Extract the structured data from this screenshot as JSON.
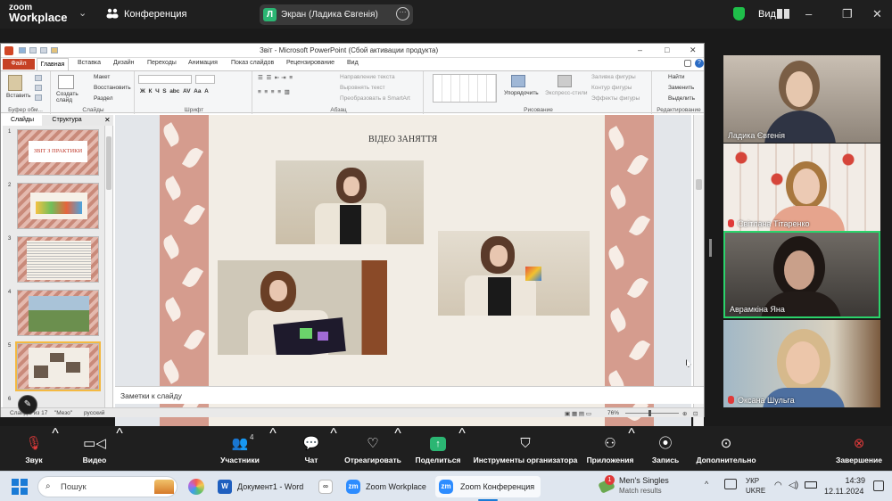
{
  "zoom_top": {
    "logo_line1": "zoom",
    "logo_line2": "Workplace",
    "meeting_title": "Конференция",
    "share_badge": "Л",
    "share_label": "Экран (Ладика Євгенія)",
    "view_label": "Вид"
  },
  "ppt": {
    "window_title": "Звіт - Microsoft PowerPoint (Сбой активации продукта)",
    "tabs": [
      "Файл",
      "Главная",
      "Вставка",
      "Дизайн",
      "Переходы",
      "Анимация",
      "Показ слайдов",
      "Рецензирование",
      "Вид"
    ],
    "ribbon": {
      "paste": "Вставить",
      "create_slide": "Создать слайд",
      "layout": "Макет",
      "restore": "Восстановить",
      "section": "Раздел",
      "text_direction": "Направление текста",
      "align_text": "Выровнять текст",
      "smartart": "Преобразовать в SmartArt",
      "arrange": "Упорядочить",
      "quick_styles": "Экспресс-стили",
      "shape_fill": "Заливка фигуры",
      "shape_outline": "Контур фигуры",
      "shape_effects": "Эффекты фигуры",
      "find": "Найти",
      "replace": "Заменить",
      "select": "Выделить",
      "groups": {
        "clipboard": "Буфер обм...",
        "slides": "Слайды",
        "font": "Шрифт",
        "paragraph": "Абзац",
        "drawing": "Рисование",
        "editing": "Редактирование"
      }
    },
    "pane_tabs": [
      "Слайды",
      "Структура"
    ],
    "thumb1_title": "ЗВІТ З ПРАКТИКИ",
    "thumb_numbers": [
      "1",
      "2",
      "3",
      "4",
      "5",
      "6"
    ],
    "slide_title": "ВІДЕО ЗАНЯТТЯ",
    "notes_placeholder": "Заметки к слайду",
    "status": {
      "slide": "Слайд 5 из 17",
      "theme": "\"Мезо\"",
      "lang": "русский",
      "zoom": "76%"
    }
  },
  "participants": [
    {
      "name": "Ладика Євгенія",
      "muted": false
    },
    {
      "name": "Світлана Тітаренко",
      "muted": true
    },
    {
      "name": "Аврамкіна Яна",
      "muted": false
    },
    {
      "name": "Оксана Шульга",
      "muted": true
    }
  ],
  "toolbar": {
    "audio": "Звук",
    "video": "Видео",
    "participants": "Участники",
    "participants_count": "4",
    "chat": "Чат",
    "react": "Отреагировать",
    "share": "Поделиться",
    "host_tools": "Инструменты организатора",
    "apps": "Приложения",
    "record": "Запись",
    "more": "Дополнительно",
    "end": "Завершение"
  },
  "taskbar": {
    "search": "Пошук",
    "word": "Документ1 - Word",
    "zoom_workplace": "Zoom Workplace",
    "zoom_conf": "Zoom Конференция",
    "notif_title": "Men's Singles",
    "notif_sub": "Match results",
    "notif_count": "1",
    "lang1": "УКР",
    "lang2": "UKRE",
    "time": "14:39",
    "date": "12.11.2024"
  },
  "colors": {
    "zoom_bar": "#1f1f1f",
    "ppt_file_tab": "#c64125",
    "active_speaker": "#2bd36b",
    "mute_red": "#e03a3a",
    "share_green": "#2bb673"
  }
}
